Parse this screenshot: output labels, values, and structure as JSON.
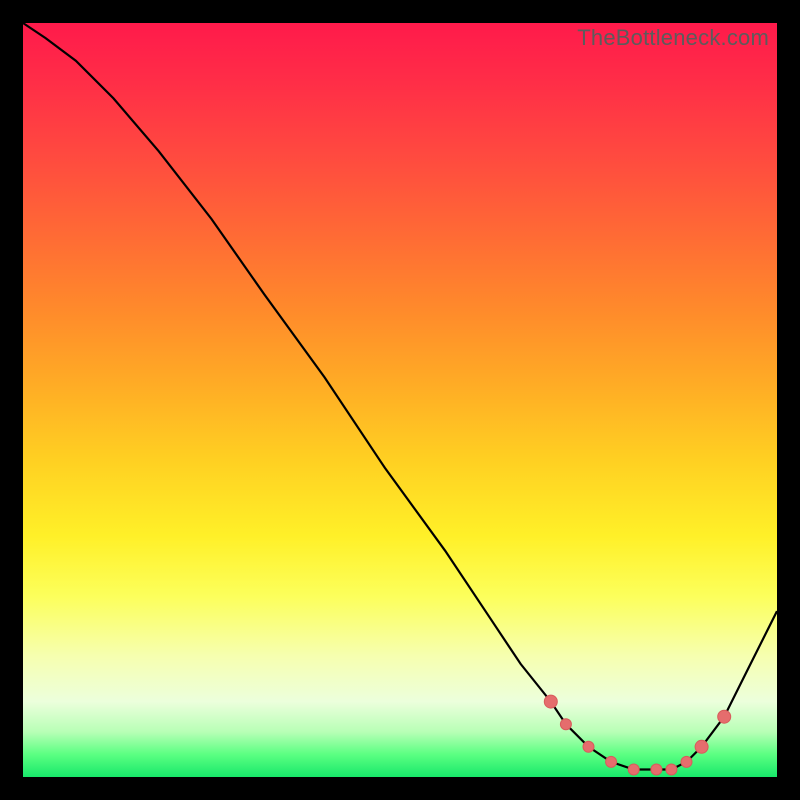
{
  "watermark": "TheBottleneck.com",
  "colors": {
    "curve_stroke": "#000000",
    "marker_fill": "#e56d6d",
    "marker_stroke": "#d85b5b"
  },
  "chart_data": {
    "type": "line",
    "title": "",
    "xlabel": "",
    "ylabel": "",
    "xlim": [
      0,
      100
    ],
    "ylim": [
      0,
      100
    ],
    "series": [
      {
        "name": "bottleneck-curve",
        "x": [
          0,
          3,
          7,
          12,
          18,
          25,
          32,
          40,
          48,
          56,
          62,
          66,
          70,
          72,
          75,
          78,
          81,
          84,
          86,
          88,
          90,
          93,
          96,
          100
        ],
        "values": [
          100,
          98,
          95,
          90,
          83,
          74,
          64,
          53,
          41,
          30,
          21,
          15,
          10,
          7,
          4,
          2,
          1,
          1,
          1,
          2,
          4,
          8,
          14,
          22
        ]
      }
    ],
    "markers": {
      "name": "highlight-points",
      "x": [
        70,
        72,
        75,
        78,
        81,
        84,
        86,
        88,
        90,
        93
      ],
      "values": [
        10,
        7,
        4,
        2,
        1,
        1,
        1,
        2,
        4,
        8
      ]
    }
  }
}
